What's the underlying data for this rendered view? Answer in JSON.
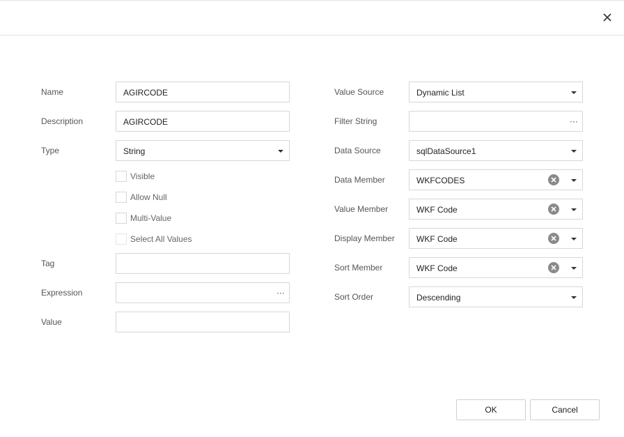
{
  "left": {
    "name": {
      "label": "Name",
      "value": "AGIRCODE"
    },
    "description": {
      "label": "Description",
      "value": "AGIRCODE"
    },
    "type": {
      "label": "Type",
      "value": "String"
    },
    "checkboxes": [
      {
        "label": "Visible",
        "checked": false
      },
      {
        "label": "Allow Null",
        "checked": false
      },
      {
        "label": "Multi-Value",
        "checked": false
      },
      {
        "label": "Select All Values",
        "checked": false
      }
    ],
    "tag": {
      "label": "Tag",
      "value": ""
    },
    "expression": {
      "label": "Expression",
      "value": "",
      "ellipsis": "···"
    },
    "value": {
      "label": "Value",
      "value": ""
    }
  },
  "right": {
    "value_source": {
      "label": "Value Source",
      "value": "Dynamic List"
    },
    "filter_string": {
      "label": "Filter String",
      "value": "",
      "ellipsis": "···"
    },
    "data_source": {
      "label": "Data Source",
      "value": "sqlDataSource1"
    },
    "data_member": {
      "label": "Data Member",
      "value": "WKFCODES"
    },
    "value_member": {
      "label": "Value Member",
      "value": "WKF Code"
    },
    "display_member": {
      "label": "Display Member",
      "value": "WKF Code"
    },
    "sort_member": {
      "label": "Sort Member",
      "value": "WKF Code"
    },
    "sort_order": {
      "label": "Sort Order",
      "value": "Descending"
    }
  },
  "footer": {
    "ok_label": "OK",
    "cancel_label": "Cancel"
  },
  "icons": {
    "close": "close-icon",
    "clear": "clear-circle-icon",
    "dropdown": "chevron-down-icon",
    "ellipsis": "ellipsis-icon"
  }
}
